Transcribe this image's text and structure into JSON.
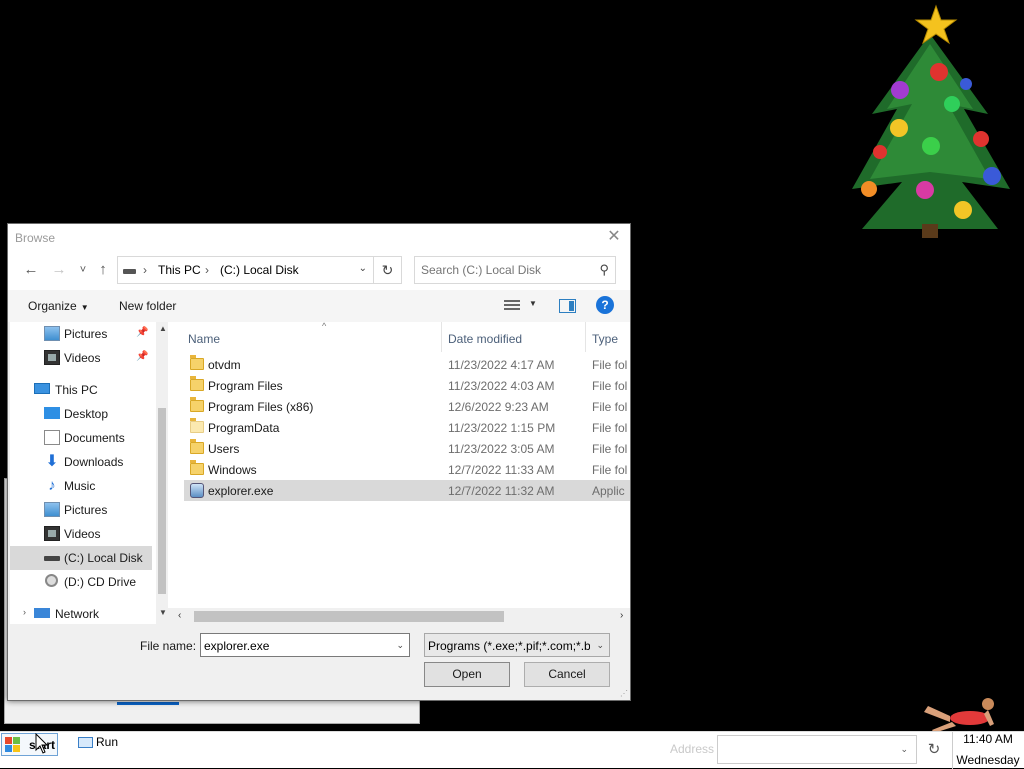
{
  "dialog": {
    "title": "Browse",
    "close_glyph": "✕"
  },
  "nav": {
    "back_glyph": "←",
    "forward_glyph": "→",
    "recent_glyph": "˅",
    "up_glyph": "↑",
    "refresh_glyph": "↻",
    "breadcrumb": [
      "This PC",
      "(C:) Local Disk"
    ],
    "search_placeholder": "Search (C:) Local Disk"
  },
  "toolbar": {
    "organize_label": "Organize",
    "new_folder_label": "New folder",
    "help_glyph": "?"
  },
  "sidebar": {
    "items": [
      {
        "label": "Pictures",
        "icon": "pictures-icon",
        "pinned": true
      },
      {
        "label": "Videos",
        "icon": "videos-icon",
        "pinned": true
      },
      {
        "label": "This PC",
        "icon": "this-pc-icon",
        "pinned": false
      },
      {
        "label": "Desktop",
        "icon": "desktop-icon",
        "pinned": false
      },
      {
        "label": "Documents",
        "icon": "documents-icon",
        "pinned": false
      },
      {
        "label": "Downloads",
        "icon": "downloads-icon",
        "pinned": false
      },
      {
        "label": "Music",
        "icon": "music-icon",
        "pinned": false
      },
      {
        "label": "Pictures",
        "icon": "pictures-icon",
        "pinned": false
      },
      {
        "label": "Videos",
        "icon": "videos-icon",
        "pinned": false
      },
      {
        "label": "(C:) Local Disk",
        "icon": "local-disk-icon",
        "pinned": false,
        "selected": true
      },
      {
        "label": "(D:) CD Drive",
        "icon": "cd-drive-icon",
        "pinned": false
      },
      {
        "label": "Network",
        "icon": "network-icon",
        "pinned": false
      }
    ]
  },
  "filelist": {
    "columns": [
      "Name",
      "Date modified",
      "Type"
    ],
    "rows": [
      {
        "name": "otvdm",
        "date": "11/23/2022 4:17 AM",
        "type": "File fol",
        "icon": "folder-icon"
      },
      {
        "name": "Program Files",
        "date": "11/23/2022 4:03 AM",
        "type": "File fol",
        "icon": "folder-icon"
      },
      {
        "name": "Program Files (x86)",
        "date": "12/6/2022 9:23 AM",
        "type": "File fol",
        "icon": "folder-icon"
      },
      {
        "name": "ProgramData",
        "date": "11/23/2022 1:15 PM",
        "type": "File fol",
        "icon": "folder-icon"
      },
      {
        "name": "Users",
        "date": "11/23/2022 3:05 AM",
        "type": "File fol",
        "icon": "folder-icon"
      },
      {
        "name": "Windows",
        "date": "12/7/2022 11:33 AM",
        "type": "File fol",
        "icon": "folder-icon"
      },
      {
        "name": "explorer.exe",
        "date": "12/7/2022 11:32 AM",
        "type": "Applic",
        "icon": "application-icon",
        "selected": true
      }
    ]
  },
  "footer": {
    "filename_label": "File name:",
    "filename_value": "explorer.exe",
    "filter_value": "Programs (*.exe;*.pif;*.com;*.bat;*.cmd)",
    "open_label": "Open",
    "cancel_label": "Cancel"
  },
  "taskbar": {
    "start_label": "start",
    "run_label": "Run",
    "address_label": "Address",
    "address_value": "",
    "go_glyph": "↻",
    "clock_time": "11:40 AM",
    "clock_day": "Wednesday"
  },
  "colors": {
    "accent": "#1a73d9",
    "selection": "#d9d9d9",
    "desktop": "#000000"
  }
}
